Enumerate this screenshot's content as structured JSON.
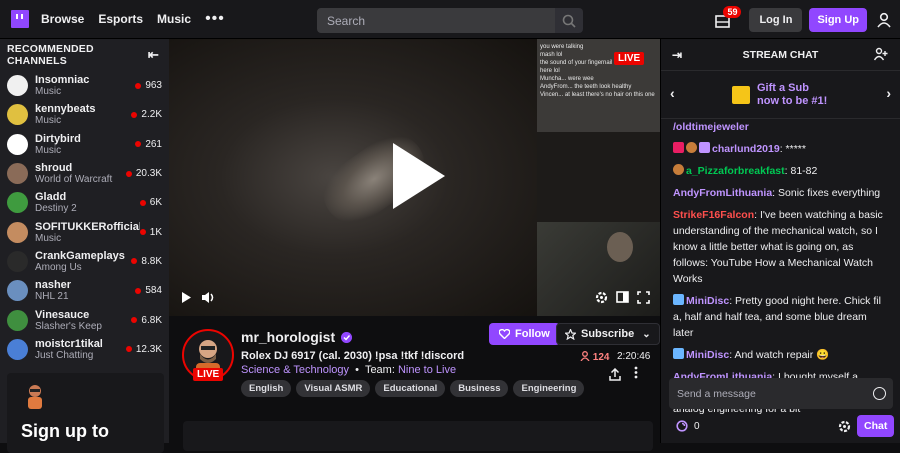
{
  "topbar": {
    "nav": [
      "Browse",
      "Esports",
      "Music"
    ],
    "more": "•••",
    "search_placeholder": "Search",
    "notification_count": "59",
    "login": "Log In",
    "signup": "Sign Up"
  },
  "sidebar": {
    "header": "RECOMMENDED CHANNELS",
    "collapse": "⇤",
    "channels": [
      {
        "name": "Insomniac",
        "game": "Music",
        "viewers": "963",
        "avatar": "#f0f0f0"
      },
      {
        "name": "kennybeats",
        "game": "Music",
        "viewers": "2.2K",
        "avatar": "#e0c040"
      },
      {
        "name": "Dirtybird",
        "game": "Music",
        "viewers": "261",
        "avatar": "#ffffff"
      },
      {
        "name": "shroud",
        "game": "World of Warcraft",
        "viewers": "20.3K",
        "avatar": "#8a6b58"
      },
      {
        "name": "Gladd",
        "game": "Destiny 2",
        "viewers": "6K",
        "avatar": "#3f9b3f"
      },
      {
        "name": "SOFITUKKERofficial",
        "game": "Music",
        "viewers": "1K",
        "avatar": "#c48c60"
      },
      {
        "name": "CrankGameplays",
        "game": "Among Us",
        "viewers": "8.8K",
        "avatar": "#2a2a2a"
      },
      {
        "name": "nasher",
        "game": "NHL 21",
        "viewers": "584",
        "avatar": "#6a8fbf"
      },
      {
        "name": "Vinesauce",
        "game": "Slasher's Keep",
        "viewers": "6.8K",
        "avatar": "#3f8f3f"
      },
      {
        "name": "moistcr1tikal",
        "game": "Just Chatting",
        "viewers": "12.3K",
        "avatar": "#4a7fd6"
      }
    ],
    "signup_prompt": "Sign up to"
  },
  "player": {
    "live": "LIVE",
    "overlay_chat": [
      "you were talking",
      "mash lol",
      "the sound of your fingernail",
      "here lol",
      "Muncha... were wee",
      "AndyFrom... the teeth look healthy",
      "Vincen... at least there's no hair on this one"
    ]
  },
  "stream": {
    "streamer": "mr_horologist",
    "live_badge": "LIVE",
    "title": "Rolex DJ 6917 (cal. 2030) !psa !tkf !discord",
    "category": "Science & Technology",
    "team_label": "Team:",
    "team": "Nine to Live",
    "tags": [
      "English",
      "Visual ASMR",
      "Educational",
      "Business",
      "Engineering"
    ],
    "follow": "Follow",
    "subscribe": "Subscribe",
    "viewers": "124",
    "uptime": "2:20:46"
  },
  "chat": {
    "header": "STREAM CHAT",
    "gift_text": "Gift a Sub now to be #1!",
    "messages": [
      {
        "user": "/oldtimejeweler",
        "text": "",
        "cls": "u-purple"
      },
      {
        "user": "charlund2019",
        "text": ": *****",
        "cls": "u-purple"
      },
      {
        "user": "a_Pizzaforbreakfast",
        "text": ": 81-82",
        "cls": "u-green"
      },
      {
        "user": "AndyFromLithuania",
        "text": ": Sonic fixes everything",
        "cls": "u-purple"
      },
      {
        "user": "StrikeF16Falcon",
        "text": ": I've been watching a basic understanding of the mechanical watch, so I know a little better what is going on, as follows: YouTube How a Mechanical Watch Works",
        "cls": "u-red"
      },
      {
        "user": "MiniDisc",
        "text": ": Pretty good night here. Chick fil a, half and half tea, and some blue dream later",
        "cls": "u-purple"
      },
      {
        "user": "MiniDisc",
        "text": ": And watch repair 😀",
        "cls": "u-purple"
      },
      {
        "user": "AndyFromLithuania",
        "text": ": I bought myself a Robotic kit for Christmas 💀 so will join the analog engineering for a bit",
        "cls": "u-purple"
      }
    ],
    "input_placeholder": "Send a message",
    "points": "0",
    "send": "Chat"
  },
  "colors": {
    "brand": "#9147ff",
    "live": "#eb0400",
    "bg": "#0e0e10"
  }
}
